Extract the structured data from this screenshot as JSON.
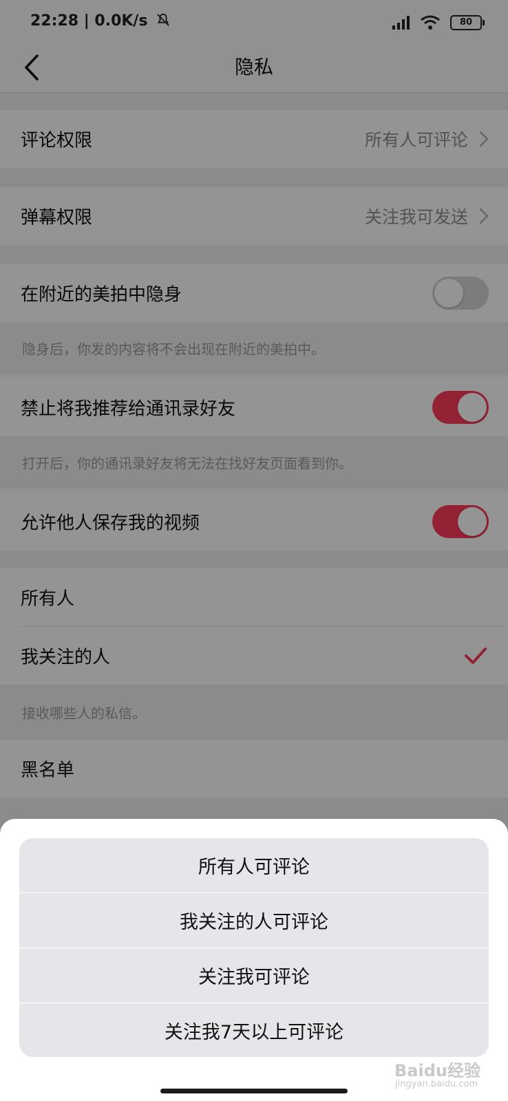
{
  "status_bar": {
    "time": "22:28",
    "speed": "0.0K/s",
    "battery": "80"
  },
  "navbar": {
    "title": "隐私"
  },
  "settings": {
    "comment_permission": {
      "label": "评论权限",
      "value": "所有人可评论"
    },
    "danmaku_permission": {
      "label": "弹幕权限",
      "value": "关注我可发送"
    },
    "hide_nearby": {
      "label": "在附近的美拍中隐身",
      "enabled": false,
      "hint": "隐身后，你发的内容将不会出现在附近的美拍中。"
    },
    "no_recommend_contacts": {
      "label": "禁止将我推荐给通讯录好友",
      "enabled": true,
      "hint": "打开后，你的通讯录好友将无法在找好友页面看到你。"
    },
    "allow_save_video": {
      "label": "允许他人保存我的视频",
      "enabled": true
    },
    "messages": {
      "options": [
        {
          "label": "所有人",
          "selected": false
        },
        {
          "label": "我关注的人",
          "selected": true
        }
      ],
      "hint": "接收哪些人的私信。"
    },
    "blacklist": {
      "label": "黑名单"
    }
  },
  "action_sheet": {
    "options": [
      "所有人可评论",
      "我关注的人可评论",
      "关注我可评论",
      "关注我7天以上可评论"
    ]
  },
  "watermark": {
    "brand": "Baidu经验",
    "url": "jingyan.baidu.com"
  },
  "colors": {
    "accent": "#ff3b5c",
    "background": "#efeff2",
    "sheet_option_bg": "#e6e6ea"
  }
}
